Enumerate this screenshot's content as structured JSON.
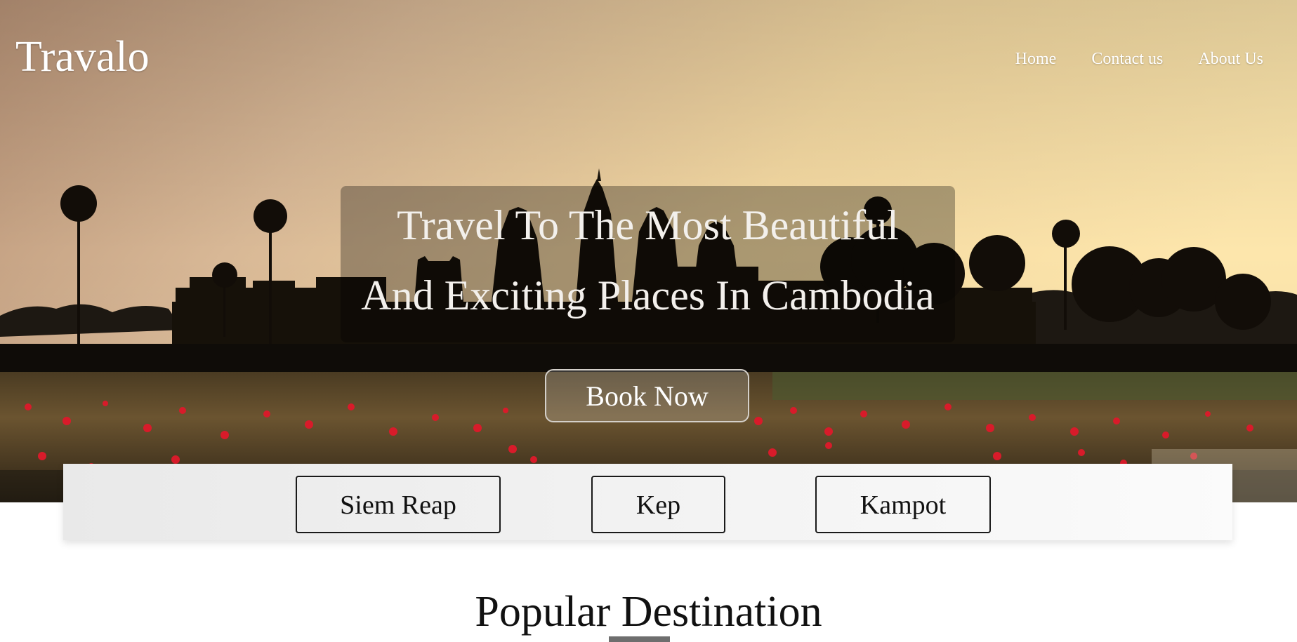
{
  "header": {
    "brand": "Travalo",
    "nav": [
      {
        "label": "Home"
      },
      {
        "label": "Contact us"
      },
      {
        "label": "About Us"
      }
    ]
  },
  "hero": {
    "headline_line1": "Travel To The Most Beautiful",
    "headline_line2": "And Exciting Places In Cambodia",
    "cta_label": "Book Now"
  },
  "cities": [
    {
      "label": "Siem Reap"
    },
    {
      "label": "Kep"
    },
    {
      "label": "Kampot"
    }
  ],
  "section": {
    "title": "Popular Destination"
  },
  "colors": {
    "sky_light": "#fbe3a6",
    "sky_warm": "#c9a482",
    "silhouette": "#15110d",
    "lotus_red": "#d81b2a",
    "underline": "#6e6e6e"
  }
}
